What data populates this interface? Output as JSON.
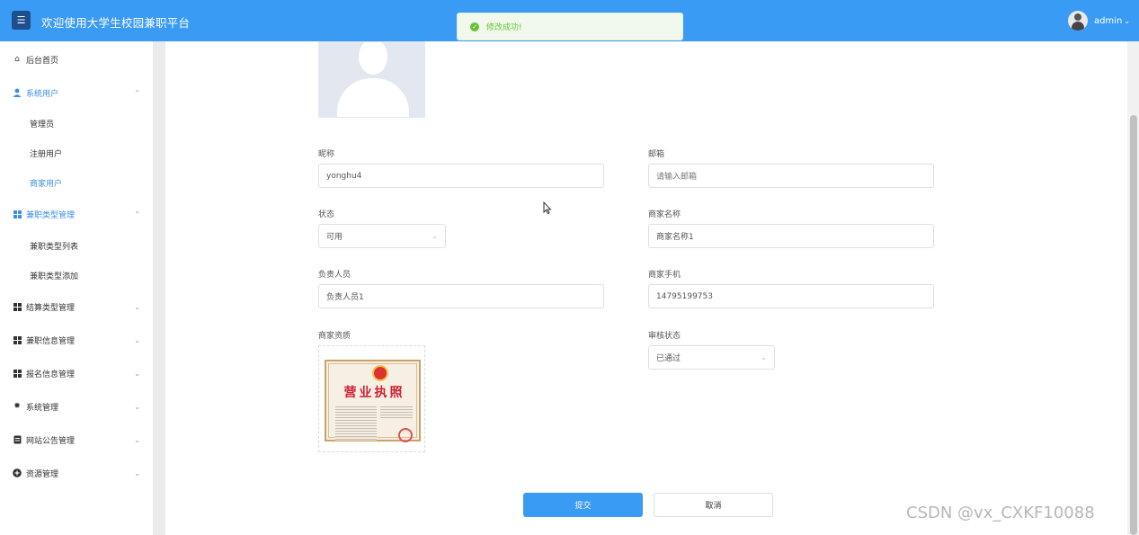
{
  "header": {
    "title": "欢迎使用大学生校园兼职平台",
    "username": "admin",
    "menu_icon": "hamburger-icon"
  },
  "toast": {
    "message": "修改成功!",
    "icon": "success-check-icon",
    "color": "#67c23a"
  },
  "sidebar": {
    "items": [
      {
        "label": "后台首页",
        "icon": "home-icon"
      },
      {
        "label": "系统用户",
        "icon": "user-icon",
        "expanded": true,
        "children": [
          {
            "label": "管理员"
          },
          {
            "label": "注册用户"
          },
          {
            "label": "商家用户",
            "active": true
          }
        ]
      },
      {
        "label": "兼职类型管理",
        "icon": "grid-icon",
        "expanded": true,
        "children": [
          {
            "label": "兼职类型列表"
          },
          {
            "label": "兼职类型添加"
          }
        ]
      },
      {
        "label": "结算类型管理",
        "icon": "grid-icon"
      },
      {
        "label": "兼职信息管理",
        "icon": "grid-icon"
      },
      {
        "label": "报名信息管理",
        "icon": "grid-icon"
      },
      {
        "label": "系统管理",
        "icon": "gear-icon"
      },
      {
        "label": "网站公告管理",
        "icon": "document-icon"
      },
      {
        "label": "资源管理",
        "icon": "plus-circle-icon"
      }
    ]
  },
  "form": {
    "nickname": {
      "label": "昵称",
      "value": "yonghu4"
    },
    "email": {
      "label": "邮箱",
      "placeholder": "请输入邮箱"
    },
    "status": {
      "label": "状态",
      "value": "可用"
    },
    "merchant_name": {
      "label": "商家名称",
      "value": "商家名称1"
    },
    "manager": {
      "label": "负责人员",
      "value": "负责人员1"
    },
    "merchant_phone": {
      "label": "商家手机",
      "value": "14795199753"
    },
    "qualification": {
      "label": "商家资质",
      "image_title": "营业执照"
    },
    "review_status": {
      "label": "审核状态",
      "value": "已通过"
    }
  },
  "buttons": {
    "submit": "提交",
    "cancel": "取消"
  },
  "watermark": "CSDN @vx_CXKF10088",
  "colors": {
    "primary": "#3a9bf5",
    "active_text": "#3a8ee6",
    "success": "#67c23a"
  }
}
